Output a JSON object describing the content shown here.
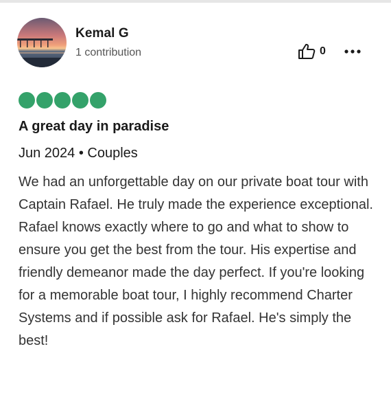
{
  "reviewer": {
    "name": "Kemal G",
    "contributions": "1 contribution"
  },
  "actions": {
    "helpful_count": "0",
    "helpful_icon": "thumbs-up-icon",
    "more_icon": "more-options-icon"
  },
  "review": {
    "rating": 5,
    "rating_max": 5,
    "rating_color": "#34a26a",
    "title": "A great day in paradise",
    "visit_meta": "Jun 2024 • Couples",
    "body": "We had an unforgettable day on our private boat tour with Captain Rafael. He truly made the experience exceptional. Rafael knows exactly where to go and what to show to ensure you get the best from the tour. His expertise and friendly demeanor made the day perfect. If you're looking for a memorable boat tour, I highly recommend Charter Systems and if possible ask for Rafael. He's simply the best!"
  }
}
